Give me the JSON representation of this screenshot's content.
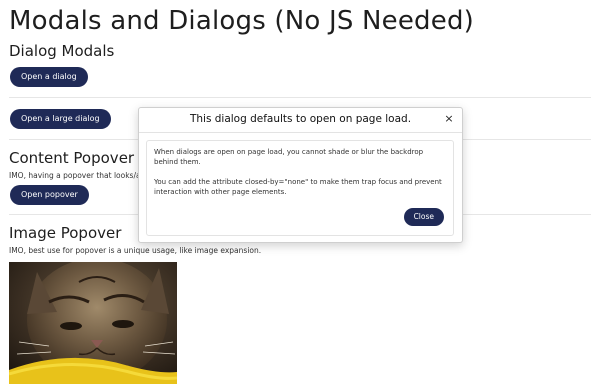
{
  "page": {
    "title": "Modals and Dialogs (No JS Needed)"
  },
  "dialog_section": {
    "heading": "Dialog Modals",
    "open_dialog_label": "Open a dialog",
    "open_large_dialog_label": "Open a large dialog"
  },
  "content_popover_section": {
    "heading": "Content Popover",
    "description": "IMO, having a popover that looks/acts",
    "open_popover_label": "Open popover"
  },
  "image_popover_section": {
    "heading": "Image Popover",
    "description": "IMO, best use for popover is a unique usage, like image expansion."
  },
  "dialog": {
    "title": "This dialog defaults to open on page load.",
    "close_icon": "×",
    "paragraph_1": "When dialogs are open on page load, you cannot shade or blur the backdrop behind them.",
    "paragraph_2": "You can add the attribute closed-by=\"none\" to make them trap focus and prevent interaction with other page elements.",
    "close_label": "Close"
  },
  "colors": {
    "button_bg": "#1f2a57",
    "button_text": "#ffffff"
  },
  "icons": {
    "dialog_close": "close-icon"
  }
}
